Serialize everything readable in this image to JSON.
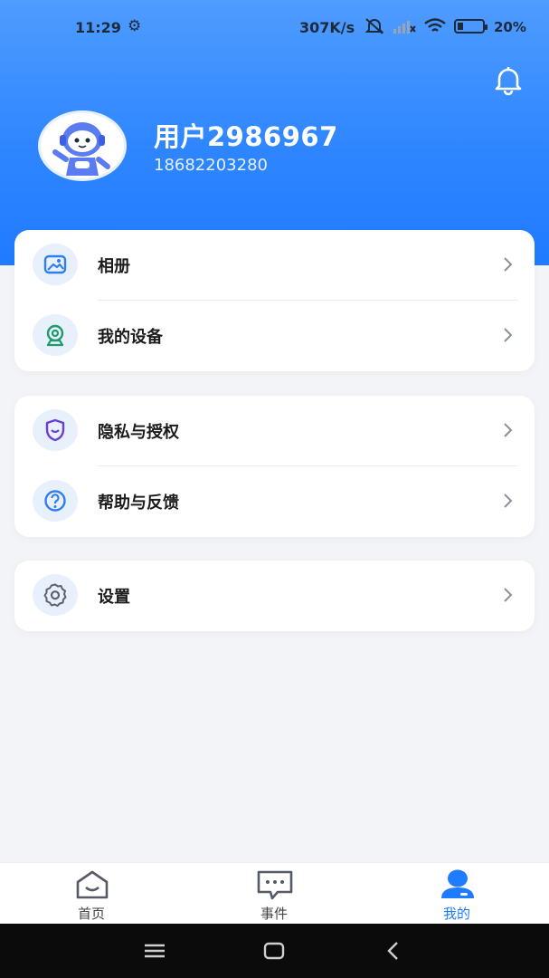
{
  "status_bar": {
    "time": "11:29",
    "network_speed": "307K/s",
    "battery": "20%"
  },
  "header": {
    "user_name": "用户2986967",
    "phone": "18682203280"
  },
  "cards": [
    {
      "items": [
        {
          "label": "相册",
          "icon": "photo-album-icon"
        },
        {
          "label": "我的设备",
          "icon": "camera-device-icon"
        }
      ]
    },
    {
      "items": [
        {
          "label": "隐私与授权",
          "icon": "shield-icon"
        },
        {
          "label": "帮助与反馈",
          "icon": "help-icon"
        }
      ]
    },
    {
      "items": [
        {
          "label": "设置",
          "icon": "gear-icon"
        }
      ]
    }
  ],
  "tabbar": {
    "tabs": [
      {
        "label": "首页",
        "icon": "home-icon"
      },
      {
        "label": "事件",
        "icon": "message-icon"
      },
      {
        "label": "我的",
        "icon": "profile-icon",
        "active": true
      }
    ]
  },
  "colors": {
    "accent": "#1f7bff",
    "header_top": "#4f9cff",
    "background": "#f2f4f7"
  }
}
